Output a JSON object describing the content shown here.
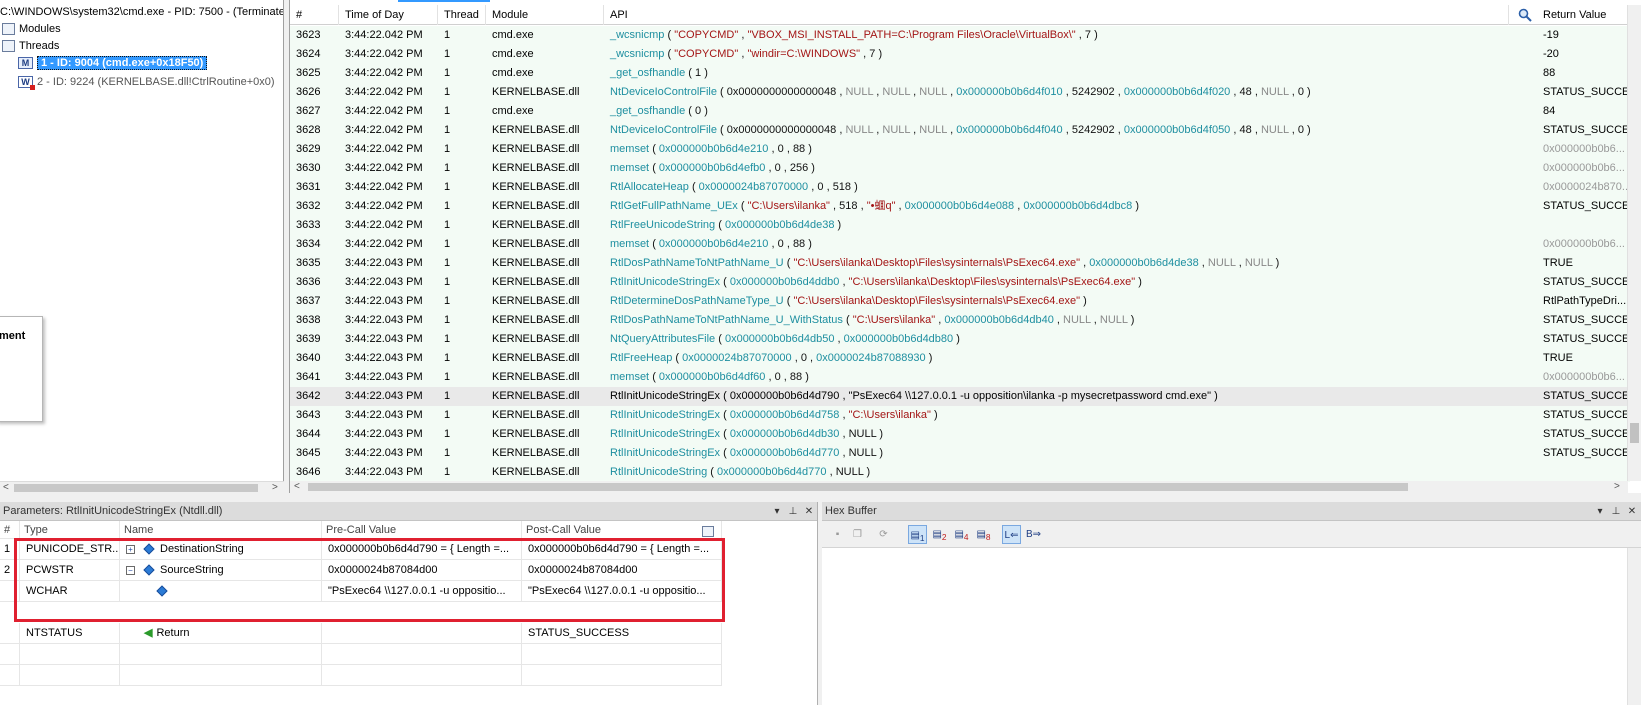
{
  "window": {
    "title": "C:\\WINDOWS\\system32\\cmd.exe - PID: 7500 - (Terminate"
  },
  "tree": {
    "modules_label": "Modules",
    "threads_label": "Threads",
    "thread1": "1 - ID: 9004 (cmd.exe+0x18F50)",
    "thread2": "2 - ID: 9224 (KERNELBASE.dll!CtrlRoutine+0x0)",
    "badge_m": "M",
    "badge_w": "W"
  },
  "floating_panel": {
    "text": "ment"
  },
  "grid": {
    "columns": [
      "#",
      "Time of Day",
      "Thread",
      "Module",
      "API",
      "Return Value"
    ],
    "search_icon": "search-icon",
    "rows": [
      {
        "n": "3623",
        "t": "3:44:22.042 PM",
        "th": "1",
        "mod": "cmd.exe",
        "api": "_wcsnicmp",
        "args": [
          [
            "(",
            ""
          ],
          [
            "\"COPYCMD\"",
            "s"
          ],
          [
            ",",
            ""
          ],
          [
            "\"VBOX_MSI_INSTALL_PATH=C:\\Program Files\\Oracle\\VirtualBox\\\"",
            "s"
          ],
          [
            ",",
            ""
          ],
          [
            "7",
            "n"
          ],
          [
            ")",
            ""
          ]
        ],
        "ret": "-19",
        "rc": ""
      },
      {
        "n": "3624",
        "t": "3:44:22.042 PM",
        "th": "1",
        "mod": "cmd.exe",
        "api": "_wcsnicmp",
        "args": [
          [
            "(",
            ""
          ],
          [
            "\"COPYCMD\"",
            "s"
          ],
          [
            ",",
            ""
          ],
          [
            "\"windir=C:\\WINDOWS\"",
            "s"
          ],
          [
            ",",
            ""
          ],
          [
            "7",
            "n"
          ],
          [
            ")",
            ""
          ]
        ],
        "ret": "-20",
        "rc": ""
      },
      {
        "n": "3625",
        "t": "3:44:22.042 PM",
        "th": "1",
        "mod": "cmd.exe",
        "api": "_get_osfhandle",
        "args": [
          [
            "(",
            ""
          ],
          [
            "1",
            "n"
          ],
          [
            ")",
            ""
          ]
        ],
        "ret": "88",
        "rc": ""
      },
      {
        "n": "3626",
        "t": "3:44:22.042 PM",
        "th": "1",
        "mod": "KERNELBASE.dll",
        "api": "NtDeviceIoControlFile",
        "args": [
          [
            "(",
            ""
          ],
          [
            "0x0000000000000048",
            "n"
          ],
          [
            ",",
            ""
          ],
          [
            "NULL",
            "x"
          ],
          [
            ",",
            ""
          ],
          [
            "NULL",
            "x"
          ],
          [
            ",",
            ""
          ],
          [
            "NULL",
            "x"
          ],
          [
            ",",
            ""
          ],
          [
            "0x000000b0b6d4f010",
            "p"
          ],
          [
            ",",
            ""
          ],
          [
            "5242902",
            "n"
          ],
          [
            ",",
            ""
          ],
          [
            "0x000000b0b6d4f020",
            "p"
          ],
          [
            ",",
            ""
          ],
          [
            "48",
            "n"
          ],
          [
            ",",
            ""
          ],
          [
            "NULL",
            "x"
          ],
          [
            ",",
            ""
          ],
          [
            "0",
            "n"
          ],
          [
            ")",
            ""
          ]
        ],
        "ret": "STATUS_SUCCESS",
        "rc": ""
      },
      {
        "n": "3627",
        "t": "3:44:22.042 PM",
        "th": "1",
        "mod": "cmd.exe",
        "api": "_get_osfhandle",
        "args": [
          [
            "(",
            ""
          ],
          [
            "0",
            "n"
          ],
          [
            ")",
            ""
          ]
        ],
        "ret": "84",
        "rc": ""
      },
      {
        "n": "3628",
        "t": "3:44:22.042 PM",
        "th": "1",
        "mod": "KERNELBASE.dll",
        "api": "NtDeviceIoControlFile",
        "args": [
          [
            "(",
            ""
          ],
          [
            "0x0000000000000048",
            "n"
          ],
          [
            ",",
            ""
          ],
          [
            "NULL",
            "x"
          ],
          [
            ",",
            ""
          ],
          [
            "NULL",
            "x"
          ],
          [
            ",",
            ""
          ],
          [
            "NULL",
            "x"
          ],
          [
            ",",
            ""
          ],
          [
            "0x000000b0b6d4f040",
            "p"
          ],
          [
            ",",
            ""
          ],
          [
            "5242902",
            "n"
          ],
          [
            ",",
            ""
          ],
          [
            "0x000000b0b6d4f050",
            "p"
          ],
          [
            ",",
            ""
          ],
          [
            "48",
            "n"
          ],
          [
            ",",
            ""
          ],
          [
            "NULL",
            "x"
          ],
          [
            ",",
            ""
          ],
          [
            "0",
            "n"
          ],
          [
            ")",
            ""
          ]
        ],
        "ret": "STATUS_SUCCESS",
        "rc": ""
      },
      {
        "n": "3629",
        "t": "3:44:22.042 PM",
        "th": "1",
        "mod": "KERNELBASE.dll",
        "api": "memset",
        "args": [
          [
            "(",
            ""
          ],
          [
            "0x000000b0b6d4e210",
            "p"
          ],
          [
            ",",
            ""
          ],
          [
            "0",
            "n"
          ],
          [
            ",",
            ""
          ],
          [
            "88",
            "n"
          ],
          [
            ")",
            ""
          ]
        ],
        "ret": "0x000000b0b6...",
        "rc": "g"
      },
      {
        "n": "3630",
        "t": "3:44:22.042 PM",
        "th": "1",
        "mod": "KERNELBASE.dll",
        "api": "memset",
        "args": [
          [
            "(",
            ""
          ],
          [
            "0x000000b0b6d4efb0",
            "p"
          ],
          [
            ",",
            ""
          ],
          [
            "0",
            "n"
          ],
          [
            ",",
            ""
          ],
          [
            "256",
            "n"
          ],
          [
            ")",
            ""
          ]
        ],
        "ret": "0x000000b0b6...",
        "rc": "g"
      },
      {
        "n": "3631",
        "t": "3:44:22.042 PM",
        "th": "1",
        "mod": "KERNELBASE.dll",
        "api": "RtlAllocateHeap",
        "args": [
          [
            "(",
            ""
          ],
          [
            "0x0000024b87070000",
            "p"
          ],
          [
            ",",
            ""
          ],
          [
            "0",
            "n"
          ],
          [
            ",",
            ""
          ],
          [
            "518",
            "n"
          ],
          [
            ")",
            ""
          ]
        ],
        "ret": "0x0000024b870...",
        "rc": "g"
      },
      {
        "n": "3632",
        "t": "3:44:22.042 PM",
        "th": "1",
        "mod": "KERNELBASE.dll",
        "api": "RtlGetFullPathName_UEx",
        "args": [
          [
            "(",
            ""
          ],
          [
            "\"C:\\Users\\ilanka\"",
            "s"
          ],
          [
            ",",
            ""
          ],
          [
            "518",
            "n"
          ],
          [
            ",",
            ""
          ],
          [
            "\"•蜖q\"",
            "s"
          ],
          [
            ",",
            ""
          ],
          [
            "0x000000b0b6d4e088",
            "p"
          ],
          [
            ",",
            ""
          ],
          [
            "0x000000b0b6d4dbc8",
            "p"
          ],
          [
            ")",
            ""
          ]
        ],
        "ret": "STATUS_SUCCESS",
        "rc": ""
      },
      {
        "n": "3633",
        "t": "3:44:22.042 PM",
        "th": "1",
        "mod": "KERNELBASE.dll",
        "api": "RtlFreeUnicodeString",
        "args": [
          [
            "(",
            ""
          ],
          [
            "0x000000b0b6d4de38",
            "p"
          ],
          [
            ")",
            ""
          ]
        ],
        "ret": "",
        "rc": ""
      },
      {
        "n": "3634",
        "t": "3:44:22.042 PM",
        "th": "1",
        "mod": "KERNELBASE.dll",
        "api": "memset",
        "args": [
          [
            "(",
            ""
          ],
          [
            "0x000000b0b6d4e210",
            "p"
          ],
          [
            ",",
            ""
          ],
          [
            "0",
            "n"
          ],
          [
            ",",
            ""
          ],
          [
            "88",
            "n"
          ],
          [
            ")",
            ""
          ]
        ],
        "ret": "0x000000b0b6...",
        "rc": "g"
      },
      {
        "n": "3635",
        "t": "3:44:22.043 PM",
        "th": "1",
        "mod": "KERNELBASE.dll",
        "api": "RtlDosPathNameToNtPathName_U",
        "args": [
          [
            "(",
            ""
          ],
          [
            "\"C:\\Users\\ilanka\\Desktop\\Files\\sysinternals\\PsExec64.exe\"",
            "s"
          ],
          [
            ",",
            ""
          ],
          [
            "0x000000b0b6d4de38",
            "p"
          ],
          [
            ",",
            ""
          ],
          [
            "NULL",
            "x"
          ],
          [
            ",",
            ""
          ],
          [
            "NULL",
            "x"
          ],
          [
            ")",
            ""
          ]
        ],
        "ret": "TRUE",
        "rc": ""
      },
      {
        "n": "3636",
        "t": "3:44:22.043 PM",
        "th": "1",
        "mod": "KERNELBASE.dll",
        "api": "RtlInitUnicodeStringEx",
        "args": [
          [
            "(",
            ""
          ],
          [
            "0x000000b0b6d4ddb0",
            "p"
          ],
          [
            ",",
            ""
          ],
          [
            "\"C:\\Users\\ilanka\\Desktop\\Files\\sysinternals\\PsExec64.exe\"",
            "s"
          ],
          [
            ")",
            ""
          ]
        ],
        "ret": "STATUS_SUCCESS",
        "rc": ""
      },
      {
        "n": "3637",
        "t": "3:44:22.043 PM",
        "th": "1",
        "mod": "KERNELBASE.dll",
        "api": "RtlDetermineDosPathNameType_U",
        "args": [
          [
            "(",
            ""
          ],
          [
            "\"C:\\Users\\ilanka\\Desktop\\Files\\sysinternals\\PsExec64.exe\"",
            "s"
          ],
          [
            ")",
            ""
          ]
        ],
        "ret": "RtlPathTypeDri...",
        "rc": ""
      },
      {
        "n": "3638",
        "t": "3:44:22.043 PM",
        "th": "1",
        "mod": "KERNELBASE.dll",
        "api": "RtlDosPathNameToNtPathName_U_WithStatus",
        "args": [
          [
            "(",
            ""
          ],
          [
            "\"C:\\Users\\ilanka\"",
            "s"
          ],
          [
            ",",
            ""
          ],
          [
            "0x000000b0b6d4db40",
            "p"
          ],
          [
            ",",
            ""
          ],
          [
            "NULL",
            "x"
          ],
          [
            ",",
            ""
          ],
          [
            "NULL",
            "x"
          ],
          [
            ")",
            ""
          ]
        ],
        "ret": "STATUS_SUCCESS",
        "rc": ""
      },
      {
        "n": "3639",
        "t": "3:44:22.043 PM",
        "th": "1",
        "mod": "KERNELBASE.dll",
        "api": "NtQueryAttributesFile",
        "args": [
          [
            "(",
            ""
          ],
          [
            "0x000000b0b6d4db50",
            "p"
          ],
          [
            ",",
            ""
          ],
          [
            "0x000000b0b6d4db80",
            "p"
          ],
          [
            ")",
            ""
          ]
        ],
        "ret": "STATUS_SUCCESS",
        "rc": ""
      },
      {
        "n": "3640",
        "t": "3:44:22.043 PM",
        "th": "1",
        "mod": "KERNELBASE.dll",
        "api": "RtlFreeHeap",
        "args": [
          [
            "(",
            ""
          ],
          [
            "0x0000024b87070000",
            "p"
          ],
          [
            ",",
            ""
          ],
          [
            "0",
            "n"
          ],
          [
            ",",
            ""
          ],
          [
            "0x0000024b87088930",
            "p"
          ],
          [
            ")",
            ""
          ]
        ],
        "ret": "TRUE",
        "rc": ""
      },
      {
        "n": "3641",
        "t": "3:44:22.043 PM",
        "th": "1",
        "mod": "KERNELBASE.dll",
        "api": "memset",
        "args": [
          [
            "(",
            ""
          ],
          [
            "0x000000b0b6d4df60",
            "p"
          ],
          [
            ",",
            ""
          ],
          [
            "0",
            "n"
          ],
          [
            ",",
            ""
          ],
          [
            "88",
            "n"
          ],
          [
            ")",
            ""
          ]
        ],
        "ret": "0x000000b0b6...",
        "rc": "g"
      },
      {
        "n": "3642",
        "t": "3:44:22.043 PM",
        "th": "1",
        "mod": "KERNELBASE.dll",
        "api": "RtlInitUnicodeStringEx",
        "args": [
          [
            "(",
            ""
          ],
          [
            "0x000000b0b6d4d790",
            "n"
          ],
          [
            ",",
            ""
          ],
          [
            "\"PsExec64  \\\\127.0.0.1 -u opposition\\ilanka -p mysecretpassword cmd.exe\"",
            "n"
          ],
          [
            ")",
            ""
          ]
        ],
        "ret": "STATUS_SUCCESS",
        "rc": "",
        "hl": true
      },
      {
        "n": "3643",
        "t": "3:44:22.043 PM",
        "th": "1",
        "mod": "KERNELBASE.dll",
        "api": "RtlInitUnicodeStringEx",
        "args": [
          [
            "(",
            ""
          ],
          [
            "0x000000b0b6d4d758",
            "p"
          ],
          [
            ",",
            ""
          ],
          [
            "\"C:\\Users\\ilanka\"",
            "s"
          ],
          [
            ")",
            ""
          ]
        ],
        "ret": "STATUS_SUCCESS",
        "rc": ""
      },
      {
        "n": "3644",
        "t": "3:44:22.043 PM",
        "th": "1",
        "mod": "KERNELBASE.dll",
        "api": "RtlInitUnicodeStringEx",
        "args": [
          [
            "(",
            ""
          ],
          [
            "0x000000b0b6d4db30",
            "p"
          ],
          [
            ",",
            ""
          ],
          [
            "NULL",
            "n"
          ],
          [
            ")",
            ""
          ]
        ],
        "ret": "STATUS_SUCCESS",
        "rc": ""
      },
      {
        "n": "3645",
        "t": "3:44:22.043 PM",
        "th": "1",
        "mod": "KERNELBASE.dll",
        "api": "RtlInitUnicodeStringEx",
        "args": [
          [
            "(",
            ""
          ],
          [
            "0x000000b0b6d4d770",
            "p"
          ],
          [
            ",",
            ""
          ],
          [
            "NULL",
            "n"
          ],
          [
            ")",
            ""
          ]
        ],
        "ret": "STATUS_SUCCESS",
        "rc": ""
      },
      {
        "n": "3646",
        "t": "3:44:22.043 PM",
        "th": "1",
        "mod": "KERNELBASE.dll",
        "api": "RtlInitUnicodeString",
        "args": [
          [
            "(",
            ""
          ],
          [
            "0x000000b0b6d4d770",
            "p"
          ],
          [
            ",",
            ""
          ],
          [
            "NULL",
            "n"
          ],
          [
            ")",
            ""
          ]
        ],
        "ret": "",
        "rc": ""
      }
    ]
  },
  "params": {
    "title": "Parameters: RtlInitUnicodeStringEx (Ntdll.dll)",
    "columns": [
      "#",
      "Type",
      "Name",
      "Pre-Call Value",
      "Post-Call Value"
    ],
    "rows": [
      {
        "n": "1",
        "type": "PUNICODE_STR...",
        "exp": "+",
        "name": "DestinationString",
        "pre": "0x000000b0b6d4d790 = { Length =...",
        "post": "0x000000b0b6d4d790 = { Length =..."
      },
      {
        "n": "2",
        "type": "PCWSTR",
        "exp": "−",
        "name": "SourceString",
        "pre": "0x0000024b87084d00",
        "post": "0x0000024b87084d00"
      },
      {
        "n": "",
        "type": "WCHAR",
        "exp": "",
        "name": "",
        "pre": "\"PsExec64  \\\\127.0.0.1 -u oppositio...",
        "post": "\"PsExec64  \\\\127.0.0.1 -u oppositio..."
      }
    ],
    "return_row": {
      "type": "NTSTATUS",
      "name": "Return",
      "post": "STATUS_SUCCESS"
    }
  },
  "hex": {
    "title": "Hex Buffer",
    "buttons": [
      "1",
      "2",
      "4",
      "8"
    ]
  },
  "colors": {
    "accent": "#3399ff",
    "highlight": "#e02030",
    "row_bg": "#f3fbf5",
    "string": "#a31515",
    "api": "#1e8fa0"
  }
}
